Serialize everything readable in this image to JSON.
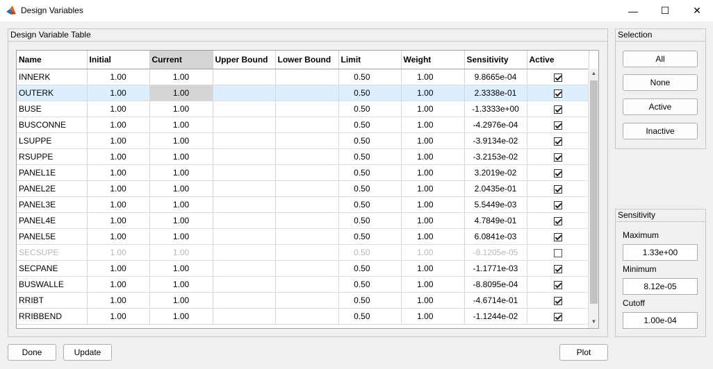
{
  "window": {
    "title": "Design Variables",
    "minimize_icon": "minimize-icon",
    "maximize_icon": "maximize-icon",
    "close_icon": "close-icon"
  },
  "table_panel": {
    "title": "Design Variable Table",
    "columns": [
      "Name",
      "Initial",
      "Current",
      "Upper Bound",
      "Lower Bound",
      "Limit",
      "Weight",
      "Sensitivity",
      "Active"
    ],
    "rows": [
      {
        "name": "INNERK",
        "initial": "1.00",
        "current": "1.00",
        "upper": "",
        "lower": "",
        "limit": "0.50",
        "weight": "1.00",
        "sensitivity": "9.8665e-04",
        "active": true
      },
      {
        "name": "OUTERK",
        "initial": "1.00",
        "current": "1.00",
        "upper": "",
        "lower": "",
        "limit": "0.50",
        "weight": "1.00",
        "sensitivity": "2.3338e-01",
        "active": true
      },
      {
        "name": "BUSE",
        "initial": "1.00",
        "current": "1.00",
        "upper": "",
        "lower": "",
        "limit": "0.50",
        "weight": "1.00",
        "sensitivity": "-1.3333e+00",
        "active": true
      },
      {
        "name": "BUSCONNE",
        "initial": "1.00",
        "current": "1.00",
        "upper": "",
        "lower": "",
        "limit": "0.50",
        "weight": "1.00",
        "sensitivity": "-4.2976e-04",
        "active": true
      },
      {
        "name": "LSUPPE",
        "initial": "1.00",
        "current": "1.00",
        "upper": "",
        "lower": "",
        "limit": "0.50",
        "weight": "1.00",
        "sensitivity": "-3.9134e-02",
        "active": true
      },
      {
        "name": "RSUPPE",
        "initial": "1.00",
        "current": "1.00",
        "upper": "",
        "lower": "",
        "limit": "0.50",
        "weight": "1.00",
        "sensitivity": "-3.2153e-02",
        "active": true
      },
      {
        "name": "PANEL1E",
        "initial": "1.00",
        "current": "1.00",
        "upper": "",
        "lower": "",
        "limit": "0.50",
        "weight": "1.00",
        "sensitivity": "3.2019e-02",
        "active": true
      },
      {
        "name": "PANEL2E",
        "initial": "1.00",
        "current": "1.00",
        "upper": "",
        "lower": "",
        "limit": "0.50",
        "weight": "1.00",
        "sensitivity": "2.0435e-01",
        "active": true
      },
      {
        "name": "PANEL3E",
        "initial": "1.00",
        "current": "1.00",
        "upper": "",
        "lower": "",
        "limit": "0.50",
        "weight": "1.00",
        "sensitivity": "5.5449e-03",
        "active": true
      },
      {
        "name": "PANEL4E",
        "initial": "1.00",
        "current": "1.00",
        "upper": "",
        "lower": "",
        "limit": "0.50",
        "weight": "1.00",
        "sensitivity": "4.7849e-01",
        "active": true
      },
      {
        "name": "PANEL5E",
        "initial": "1.00",
        "current": "1.00",
        "upper": "",
        "lower": "",
        "limit": "0.50",
        "weight": "1.00",
        "sensitivity": "6.0841e-03",
        "active": true
      },
      {
        "name": "SECSUPE",
        "initial": "1.00",
        "current": "1.00",
        "upper": "",
        "lower": "",
        "limit": "0.50",
        "weight": "1.00",
        "sensitivity": "-8.1205e-05",
        "active": false
      },
      {
        "name": "SECPANE",
        "initial": "1.00",
        "current": "1.00",
        "upper": "",
        "lower": "",
        "limit": "0.50",
        "weight": "1.00",
        "sensitivity": "-1.1771e-03",
        "active": true
      },
      {
        "name": "BUSWALLE",
        "initial": "1.00",
        "current": "1.00",
        "upper": "",
        "lower": "",
        "limit": "0.50",
        "weight": "1.00",
        "sensitivity": "-8.8095e-04",
        "active": true
      },
      {
        "name": "RRIBT",
        "initial": "1.00",
        "current": "1.00",
        "upper": "",
        "lower": "",
        "limit": "0.50",
        "weight": "1.00",
        "sensitivity": "-4.6714e-01",
        "active": true
      },
      {
        "name": "RRIBBEND",
        "initial": "1.00",
        "current": "1.00",
        "upper": "",
        "lower": "",
        "limit": "0.50",
        "weight": "1.00",
        "sensitivity": "-1.1244e-02",
        "active": true
      }
    ],
    "selected_row": "OUTERK",
    "selected_column": "Current"
  },
  "selection_panel": {
    "title": "Selection",
    "buttons": [
      "All",
      "None",
      "Active",
      "Inactive"
    ]
  },
  "sensitivity_panel": {
    "title": "Sensitivity",
    "maximum_label": "Maximum",
    "maximum_value": "1.33e+00",
    "minimum_label": "Minimum",
    "minimum_value": "8.12e-05",
    "cutoff_label": "Cutoff",
    "cutoff_value": "1.00e-04"
  },
  "footer": {
    "done_label": "Done",
    "update_label": "Update",
    "plot_label": "Plot"
  },
  "colors": {
    "selected_row": "#ddeeff",
    "selected_column": "#d4d4d4",
    "disabled_text": "#b8b8b8"
  }
}
